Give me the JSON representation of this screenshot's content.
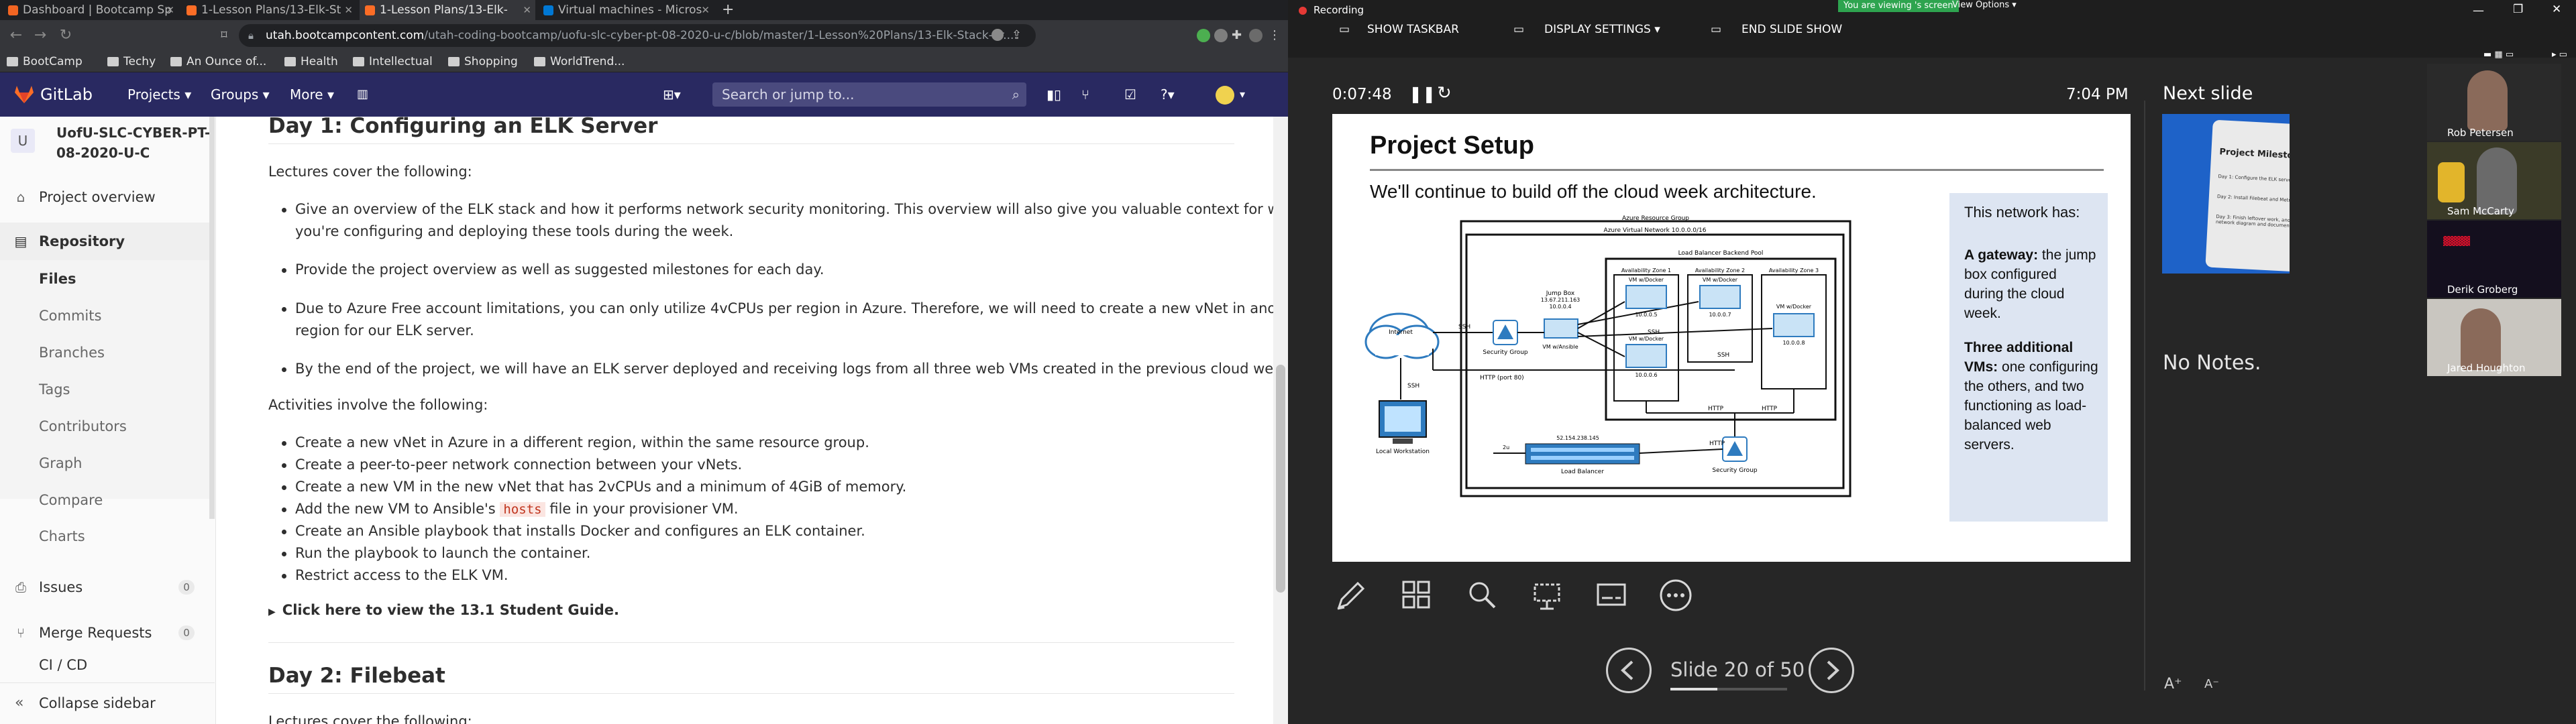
{
  "browser": {
    "tabs": [
      {
        "label": "Dashboard | Bootcamp Sp",
        "color": "#f26522"
      },
      {
        "label": "1-Lesson Plans/13-Elk-St",
        "color": "#fc6d26"
      },
      {
        "label": "1-Lesson Plans/13-Elk-",
        "color": "#fc6d26"
      },
      {
        "label": "Virtual machines - Micros",
        "color": "#0078d4"
      }
    ],
    "url_host": "utah.bootcampcontent.com",
    "url_path": "/utah-coding-bootcamp/uofu-slc-cyber-pt-08-2020-u-c/blob/master/1-Lesson%20Plans/13-Elk-Stack-Pr...",
    "bookmarks": [
      "BootCamp",
      "Techy",
      "An Ounce of...",
      "Health",
      "Intellectual",
      "Shopping",
      "WorldTrend..."
    ]
  },
  "gitlab": {
    "logo": "GitLab",
    "nav": [
      "Projects ▾",
      "Groups ▾",
      "More ▾"
    ],
    "search_placeholder": "Search or jump to...",
    "project_initial": "U",
    "project_name_1": "UofU-SLC-CYBER-PT-",
    "project_name_2": "08-2020-U-C",
    "sidebar": {
      "overview": "Project overview",
      "repository": "Repository",
      "sub": [
        "Files",
        "Commits",
        "Branches",
        "Tags",
        "Contributors",
        "Graph",
        "Compare",
        "Charts"
      ],
      "issues": "Issues",
      "issues_count": "0",
      "merge_requests": "Merge Requests",
      "mr_count": "0",
      "cicd": "CI / CD",
      "collapse": "Collapse sidebar"
    }
  },
  "doc": {
    "day1_title": "Day 1: Configuring an ELK Server",
    "lectures_intro": "Lectures cover the following:",
    "lectures": [
      "Give an overview of the ELK stack and how it performs network security monitoring. This overview will also give you valuable context for why",
      "you're configuring and deploying these tools during the week.",
      "Provide the project overview as well as suggested milestones for each day.",
      "Due to Azure Free account limitations, you can only utilize 4vCPUs per region in Azure. Therefore, we will need to create a new vNet in another",
      "region for our ELK server.",
      "By the end of the project, we will have an ELK server deployed and receiving logs from all three web VMs created in the previous cloud weeks."
    ],
    "activities_intro": "Activities involve the following:",
    "activities": [
      "Create a new vNet in Azure in a different region, within the same resource group.",
      "Create a peer-to-peer network connection between your vNets.",
      "Create a new VM in the new vNet that has 2vCPUs and a minimum of 4GiB of memory.",
      "Add the new VM to Ansible's ",
      "hosts",
      " file in your provisioner VM.",
      "Create an Ansible playbook that installs Docker and configures an ELK container.",
      "Run the playbook to launch the container.",
      "Restrict access to the ELK VM."
    ],
    "student_guide": "Click here to view the 13.1 Student Guide.",
    "day2_title": "Day 2: Filebeat",
    "day2_intro": "Lectures cover the following:"
  },
  "presenter": {
    "recording": "Recording",
    "viewing_banner": "You are viewing 's screen",
    "view_options": "View Options ▾",
    "show_taskbar": "SHOW TASKBAR",
    "display_settings": "DISPLAY SETTINGS ▾",
    "end_show": "END SLIDE SHOW",
    "timer": "0:07:48",
    "clock": "7:04 PM",
    "next_slide": "Next slide",
    "notes": "No Notes.",
    "slide_counter": "Slide 20 of 50",
    "progress": 0.4,
    "participants": [
      "Rob Petersen",
      "Sam McCarty",
      "Derik Groberg",
      "Jared Houghton"
    ]
  },
  "slide": {
    "title": "Project Setup",
    "subtitle": "We'll continue to build off the cloud week architecture.",
    "sidebox_title": "This network has:",
    "gateway_bold": "A gateway:",
    "gateway_text": " the jump box configured during the cloud week.",
    "three_bold": "Three additional VMs:",
    "three_text": " one configuring the others, and two functioning as load-balanced web servers.",
    "diagram": {
      "resource_group": "Azure Resource Group",
      "vnet": "Azure Virtual Network 10.0.0.0/16",
      "lb_pool": "Load Balancer Backend Pool",
      "zone1": "Availability Zone 1",
      "zone2": "Availability Zone 2",
      "zone3": "Availability Zone 3",
      "internet": "Internet",
      "local_ws": "Local Workstation",
      "ssh": "SSH",
      "http80": "HTTP (port 80)",
      "http": "HTTP",
      "sg": "Security Group",
      "jumpbox": "Jump Box",
      "jump_ip1": "13.67.211.163",
      "jump_ip2": "10.0.0.4",
      "vm_ansible": "VM w/Ansible",
      "vm_docker": "VM w/Docker",
      "ip5": "10.0.0.5",
      "ip6": "10.0.0.6",
      "ip7": "10.0.0.7",
      "ip8": "10.0.0.8",
      "lb_ip": "52.154.238.145",
      "lb": "Load Balancer",
      "lb_label": "Load Balancer"
    }
  },
  "next_preview": {
    "title": "Project Milestones",
    "items": [
      "Day 1: Configure the ELK server.",
      "Day 2: Install Filebeat and Metricbeat",
      "Day 3: Finish leftover work, and create a network diagram and documentation."
    ]
  }
}
